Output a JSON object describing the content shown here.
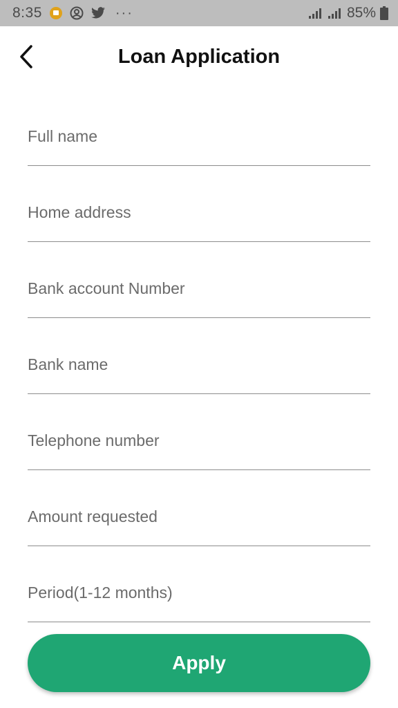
{
  "status_bar": {
    "time": "8:35",
    "battery_percent": "85%",
    "overflow": "···"
  },
  "header": {
    "title": "Loan Application",
    "back_icon": "chevron-left-icon"
  },
  "form": {
    "fields": [
      {
        "placeholder": "Full name",
        "value": ""
      },
      {
        "placeholder": "Home address",
        "value": ""
      },
      {
        "placeholder": "Bank account Number",
        "value": ""
      },
      {
        "placeholder": "Bank name",
        "value": ""
      },
      {
        "placeholder": "Telephone number",
        "value": ""
      },
      {
        "placeholder": "Amount requested",
        "value": ""
      },
      {
        "placeholder": "Period(1-12 months)",
        "value": ""
      }
    ]
  },
  "actions": {
    "apply_label": "Apply"
  },
  "colors": {
    "accent": "#1fa673",
    "status_bar": "#bdbdbd",
    "notification_badge": "#e0a21b"
  }
}
